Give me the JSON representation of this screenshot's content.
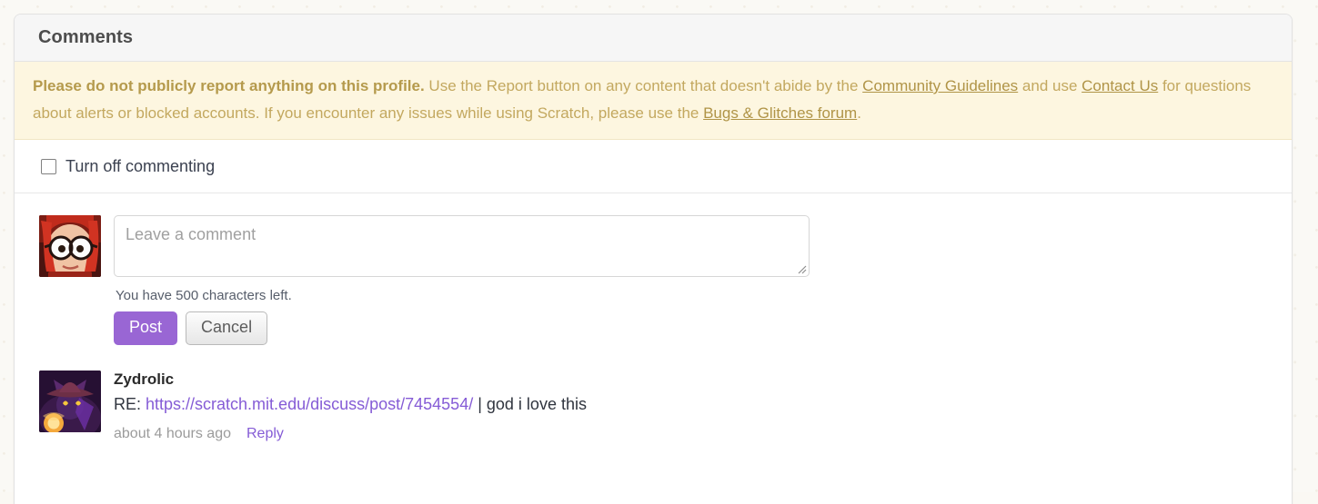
{
  "card": {
    "header_title": "Comments"
  },
  "banner": {
    "bold_lead": "Please do not publicly report anything on this profile.",
    "text_1": " Use the Report button on any content that doesn't abide by the ",
    "link_guidelines": "Community Guidelines",
    "text_2": " and use ",
    "link_contact": "Contact Us",
    "text_3": " for questions about alerts or blocked accounts. If you encounter any issues while using Scratch, please use the ",
    "link_bugs": "Bugs & Glitches forum",
    "text_4": "."
  },
  "commenting_toggle": {
    "label": "Turn off commenting",
    "checked": false
  },
  "composer": {
    "avatar_name": "user-avatar-red-hair-glasses",
    "placeholder": "Leave a comment",
    "value": "",
    "char_counter": "You have 500 characters left.",
    "post_label": "Post",
    "cancel_label": "Cancel",
    "post_color": "#9966d4"
  },
  "comments": [
    {
      "avatar_name": "commenter-avatar-purple-cat-wizard",
      "username": "Zydrolic",
      "prefix": "RE: ",
      "link_text": "https://scratch.mit.edu/discuss/post/7454554/",
      "suffix": " | god i love this",
      "timestamp": "about 4 hours ago",
      "reply_label": "Reply"
    }
  ]
}
